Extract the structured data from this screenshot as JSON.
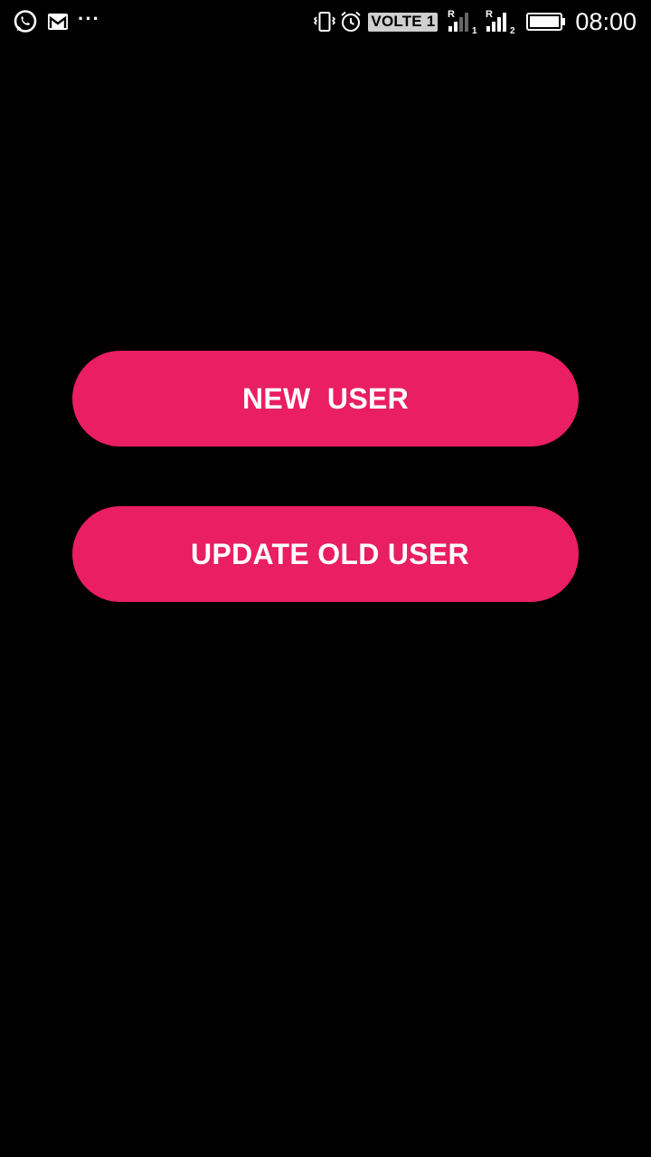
{
  "status_bar": {
    "left_icons": [
      "whatsapp-icon",
      "gmail-icon",
      "more-notifications-icon"
    ],
    "more_label": "···",
    "right_icons": [
      "vibrate-icon",
      "alarm-icon",
      "volte-badge",
      "signal-sim1-icon",
      "signal-sim2-icon",
      "battery-icon"
    ],
    "volte_label": "VOLTE 1",
    "sim1_roaming": "R",
    "sim1_index": "1",
    "sim2_roaming": "R",
    "sim2_index": "2",
    "time": "08:00"
  },
  "main": {
    "new_user_label": "NEW  USER",
    "update_user_label": "UPDATE OLD USER"
  },
  "colors": {
    "background": "#000000",
    "button": "#e91e63",
    "button_text": "#ffffff"
  }
}
